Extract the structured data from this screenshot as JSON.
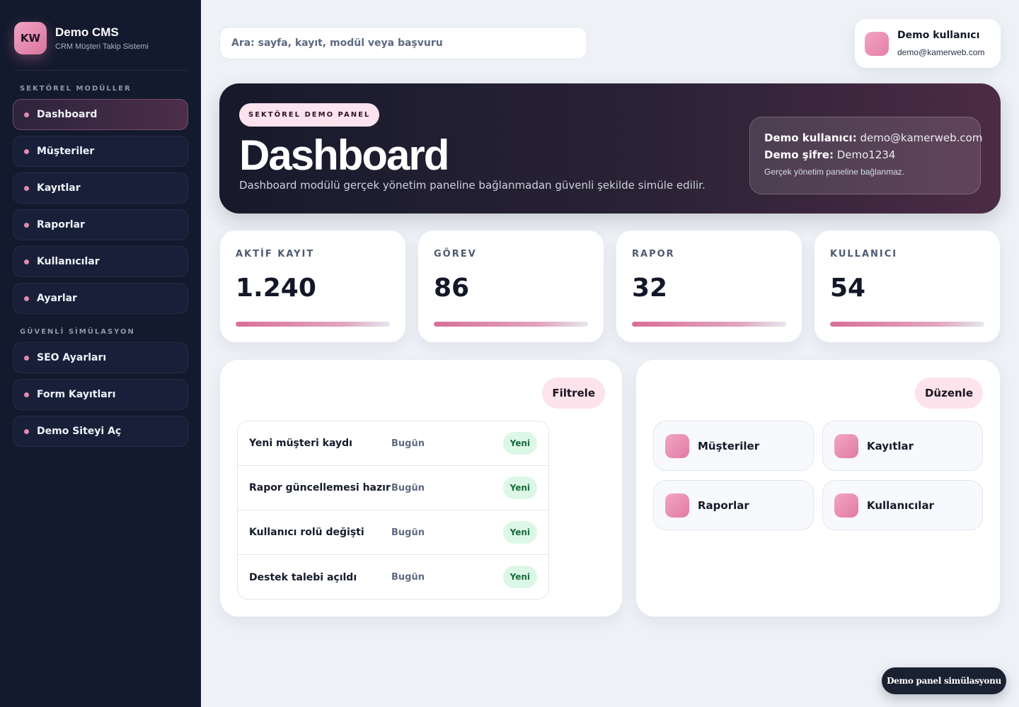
{
  "brand": {
    "logo_text": "KW",
    "name": "Demo CMS",
    "subtitle": "CRM Müşteri Takip Sistemi"
  },
  "sidebar": {
    "section_1": "SEKTÖREL MODÜLLER",
    "items": [
      {
        "label": "Dashboard",
        "active": true
      },
      {
        "label": "Müşteriler"
      },
      {
        "label": "Kayıtlar"
      },
      {
        "label": "Raporlar"
      },
      {
        "label": "Kullanıcılar"
      },
      {
        "label": "Ayarlar"
      }
    ],
    "section_2": "GÜVENLİ SİMÜLASYON",
    "items_2": [
      {
        "label": "SEO Ayarları"
      },
      {
        "label": "Form Kayıtları"
      },
      {
        "label": "Demo Siteyi Aç"
      }
    ]
  },
  "search": {
    "placeholder": "Ara: sayfa, kayıt, modül veya başvuru"
  },
  "user": {
    "name": "Demo kullanıcı",
    "email": "demo@kamerweb.com"
  },
  "hero": {
    "badge": "SEKTÖREL DEMO PANEL",
    "title": "Dashboard",
    "description": "Dashboard modülü gerçek yönetim paneline bağlanmadan güvenli şekilde simüle edilir.",
    "creds": {
      "user_label": "Demo kullanıcı:",
      "user_value": "demo@kamerweb.com",
      "pass_label": "Demo şifre:",
      "pass_value": "Demo1234",
      "note": "Gerçek yönetim paneline bağlanmaz."
    }
  },
  "stats": [
    {
      "label": "AKTİF KAYIT",
      "value": "1.240"
    },
    {
      "label": "GÖREV",
      "value": "86"
    },
    {
      "label": "RAPOR",
      "value": "32"
    },
    {
      "label": "KULLANICI",
      "value": "54"
    }
  ],
  "activity": {
    "button": "Filtrele",
    "rows": [
      {
        "title": "Yeni müşteri kaydı",
        "time": "Bugün",
        "badge": "Yeni"
      },
      {
        "title": "Rapor güncellemesi hazır",
        "time": "Bugün",
        "badge": "Yeni"
      },
      {
        "title": "Kullanıcı rolü değişti",
        "time": "Bugün",
        "badge": "Yeni"
      },
      {
        "title": "Destek talebi açıldı",
        "time": "Bugün",
        "badge": "Yeni"
      }
    ]
  },
  "shortcuts": {
    "button": "Düzenle",
    "items": [
      {
        "label": "Müşteriler"
      },
      {
        "label": "Kayıtlar"
      },
      {
        "label": "Raporlar"
      },
      {
        "label": "Kullanıcılar"
      }
    ]
  },
  "footer": {
    "pill": "Demo panel simülasyonu"
  },
  "colors": {
    "sidebar_bg": "#131a2e",
    "accent_pink": "#e17fa6",
    "page_bg": "#eef2f7",
    "badge_green_bg": "#ddf7e6"
  }
}
